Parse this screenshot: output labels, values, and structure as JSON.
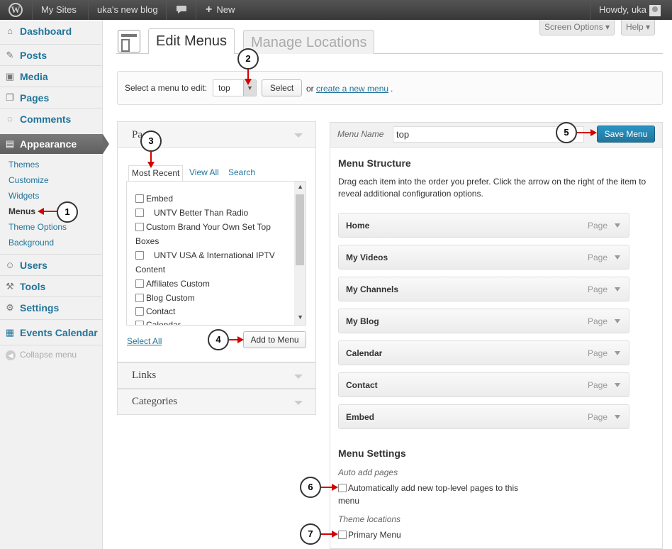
{
  "adminbar": {
    "wp_logo": "W",
    "my_sites": "My Sites",
    "site_name": "uka's new blog",
    "comments_icon": "speech-bubble-icon",
    "new_plus": "+",
    "new_label": "New",
    "howdy": "Howdy, uka"
  },
  "sidebar": {
    "dashboard": "Dashboard",
    "posts": "Posts",
    "media": "Media",
    "pages": "Pages",
    "comments": "Comments",
    "appearance": "Appearance",
    "sub": {
      "themes": "Themes",
      "customize": "Customize",
      "widgets": "Widgets",
      "menus": "Menus",
      "theme_options": "Theme Options",
      "background": "Background"
    },
    "users": "Users",
    "tools": "Tools",
    "settings": "Settings",
    "events_calendar": "Events Calendar",
    "collapse": "Collapse menu"
  },
  "header": {
    "screen_options": "Screen Options ▾",
    "help": "Help ▾",
    "tab_edit": "Edit Menus",
    "tab_manage": "Manage Locations"
  },
  "select_menu": {
    "label": "Select a menu to edit:",
    "value": "top",
    "select_button": "Select",
    "or_text": "or",
    "create_link": "create a new menu",
    "period": "."
  },
  "left": {
    "pages_title": "Pa",
    "tabs": [
      "Most Recent",
      "View All",
      "Search"
    ],
    "items": [
      {
        "label": "Embed",
        "indent": false
      },
      {
        "label": "UNTV  Better Than Radio",
        "indent": true
      },
      {
        "label": "Custom Brand Your Own Set Top",
        "indent": false
      },
      {
        "label": "Boxes",
        "continuation": true
      },
      {
        "label": "UNTV  USA & International IPTV",
        "indent": true
      },
      {
        "label": "Content",
        "continuation": true
      },
      {
        "label": "Affiliates Custom",
        "indent": false
      },
      {
        "label": "Blog Custom",
        "indent": false
      },
      {
        "label": "Contact",
        "indent": false
      },
      {
        "label": "Calendar",
        "indent": false
      }
    ],
    "select_all": "Select All",
    "add_to_menu": "Add to Menu",
    "links": "Links",
    "categories": "Categories"
  },
  "right": {
    "menu_name_label": "Menu Name",
    "menu_name_value": "top",
    "save_menu": "Save Menu",
    "structure_title": "Menu Structure",
    "structure_desc": "Drag each item into the order you prefer. Click the arrow on the right of the item to reveal additional configuration options.",
    "items": [
      {
        "title": "Home",
        "kind": "Page"
      },
      {
        "title": "My Videos",
        "kind": "Page"
      },
      {
        "title": "My Channels",
        "kind": "Page"
      },
      {
        "title": "My Blog",
        "kind": "Page"
      },
      {
        "title": "Calendar",
        "kind": "Page"
      },
      {
        "title": "Contact",
        "kind": "Page"
      },
      {
        "title": "Embed",
        "kind": "Page"
      }
    ],
    "settings_title": "Menu Settings",
    "auto_add_label": "Auto add pages",
    "auto_add_text_1": "Automatically add new top-level pages to this",
    "auto_add_text_2": "menu",
    "theme_locations_label": "Theme locations",
    "primary_menu": "Primary Menu"
  },
  "callouts": [
    "1",
    "2",
    "3",
    "4",
    "5",
    "6",
    "7"
  ]
}
